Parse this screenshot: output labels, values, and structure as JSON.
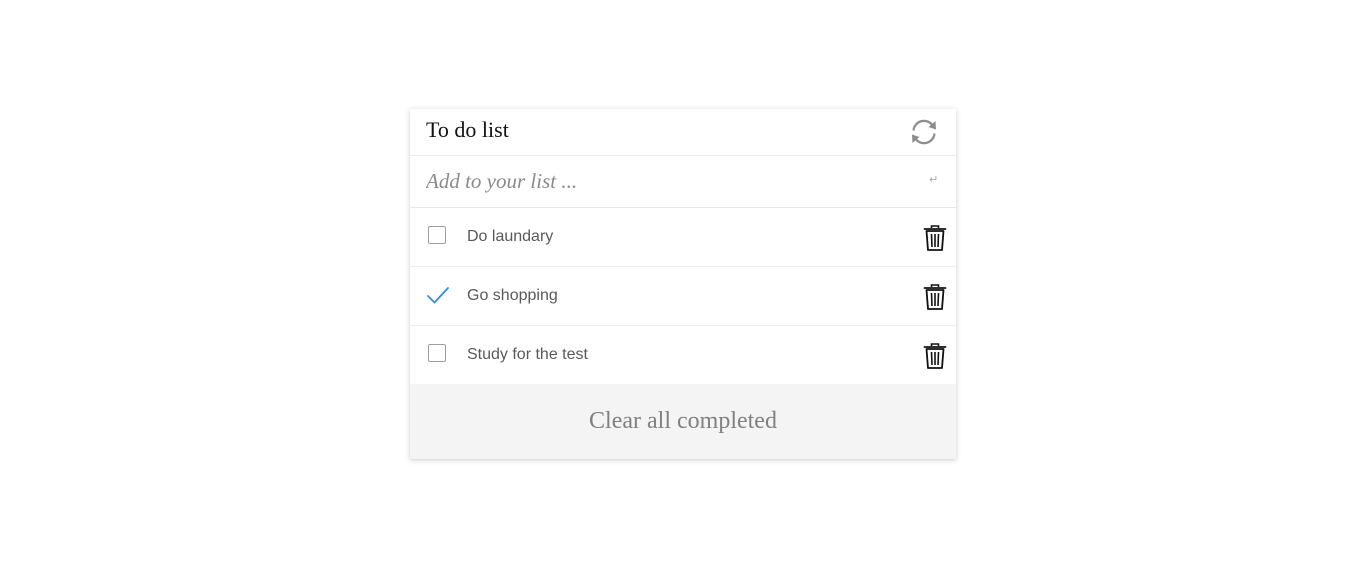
{
  "header": {
    "title": "To do list",
    "refresh_icon": "refresh-icon"
  },
  "add_input": {
    "placeholder": "Add to your list ...",
    "value": "",
    "enter_icon_glyph": "↵"
  },
  "todos": [
    {
      "label": "Do laundary",
      "completed": false
    },
    {
      "label": "Go shopping",
      "completed": true
    },
    {
      "label": "Study for the test",
      "completed": false
    }
  ],
  "footer": {
    "clear_label": "Clear all completed"
  },
  "colors": {
    "check_accent": "#2f8fe8",
    "icon_gray": "#8c8c8c",
    "footer_bg": "#f4f4f4"
  }
}
